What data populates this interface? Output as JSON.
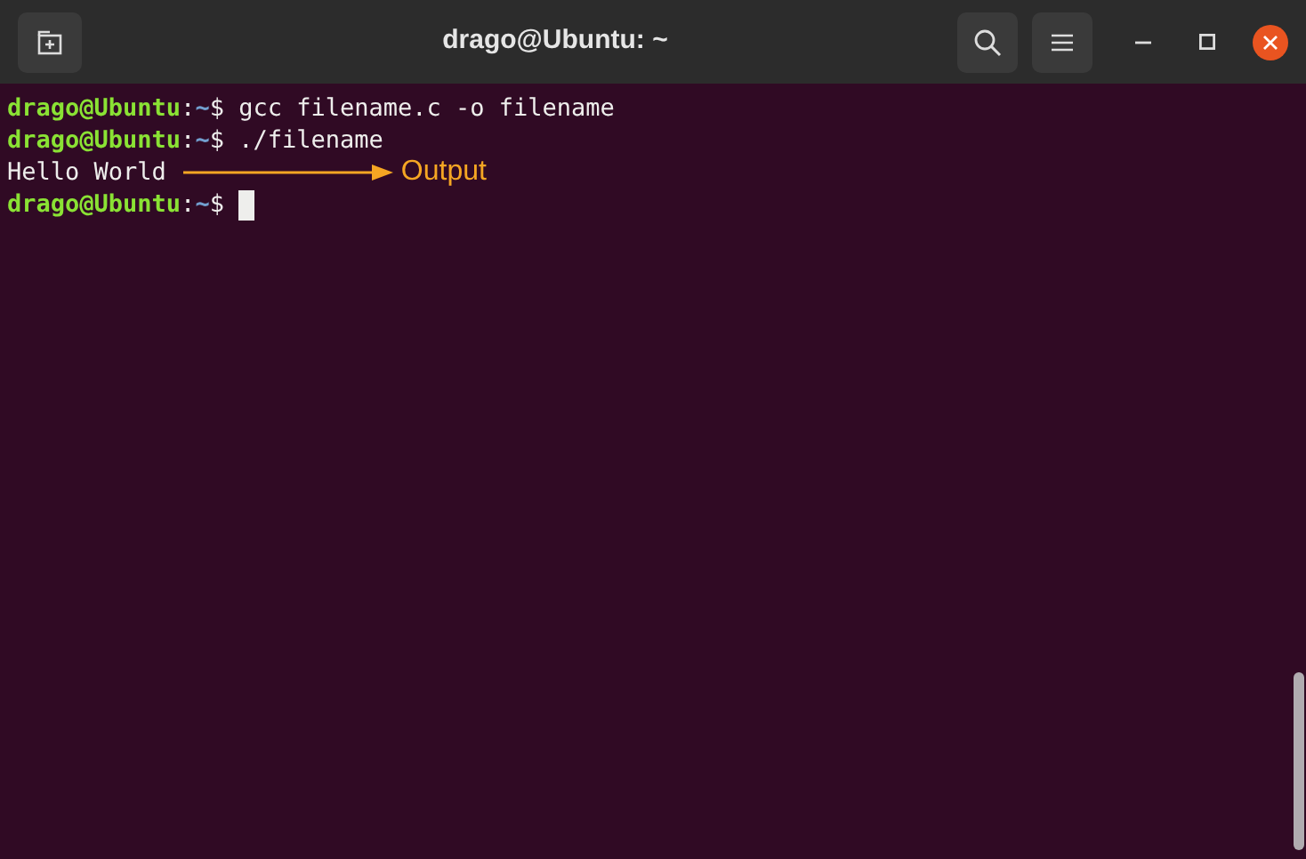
{
  "window": {
    "title": "drago@Ubuntu: ~"
  },
  "lines": [
    {
      "kind": "prompt",
      "user": "drago@Ubuntu",
      "separator": ":",
      "path": "~",
      "symbol": "$",
      "command": "gcc filename.c -o filename",
      "cursor": false
    },
    {
      "kind": "prompt",
      "user": "drago@Ubuntu",
      "separator": ":",
      "path": "~",
      "symbol": "$",
      "command": "./filename",
      "cursor": false
    },
    {
      "kind": "output",
      "text": "Hello World",
      "annotation": "Output"
    },
    {
      "kind": "prompt",
      "user": "drago@Ubuntu",
      "separator": ":",
      "path": "~",
      "symbol": "$",
      "cursor": true
    }
  ]
}
